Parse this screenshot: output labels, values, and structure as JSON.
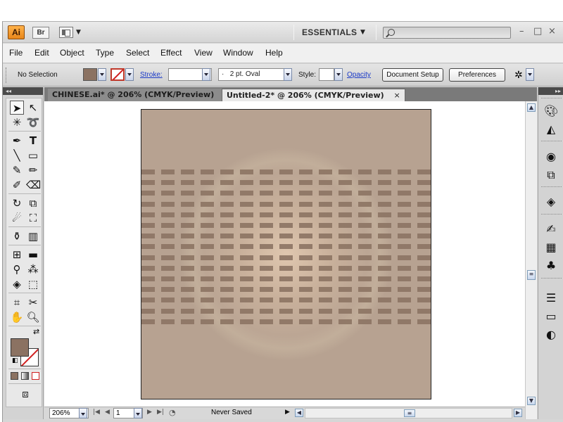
{
  "app": {
    "logo": "Ai",
    "bridge_label": "Br",
    "workspace": "ESSENTIALS",
    "search_placeholder": "",
    "window_controls": {
      "minimize": "–",
      "restore": "□",
      "close": "×"
    }
  },
  "menu": [
    "File",
    "Edit",
    "Object",
    "Type",
    "Select",
    "Effect",
    "View",
    "Window",
    "Help"
  ],
  "control_bar": {
    "selection_label": "No Selection",
    "fill_color": "#8b7262",
    "stroke_label": "Stroke:",
    "stroke_weight": "",
    "brush_label": "2 pt. Oval",
    "brush_prefix": "·",
    "style_label": "Style:",
    "opacity_label": "Opacity",
    "document_setup": "Document Setup",
    "preferences": "Preferences"
  },
  "tabs": [
    {
      "label": "CHINESE.ai* @ 206% (CMYK/Preview)",
      "close": "×",
      "active": false
    },
    {
      "label": "Untitled-2* @ 206% (CMYK/Preview)",
      "close": "×",
      "active": true
    }
  ],
  "tools": [
    "selection-tool",
    "direct-selection-tool",
    "magic-wand-tool",
    "lasso-tool",
    "pen-tool",
    "type-tool",
    "line-segment-tool",
    "rectangle-tool",
    "paintbrush-tool",
    "pencil-tool",
    "blob-brush-tool",
    "eraser-tool",
    "rotate-tool",
    "scale-tool",
    "warp-tool",
    "free-transform-tool",
    "symbol-sprayer-tool",
    "column-graph-tool",
    "mesh-tool",
    "gradient-tool",
    "eyedropper-tool",
    "blend-tool",
    "live-paint-bucket-tool",
    "live-paint-selection-tool",
    "artboard-tool",
    "slice-tool",
    "hand-tool",
    "zoom-tool"
  ],
  "colors": {
    "fill": "#8b7262",
    "stroke_none": "#d02020",
    "artboard_base": "#b7a291",
    "stripe": "#8d7564"
  },
  "status_bar": {
    "zoom": "206%",
    "page": "1",
    "status_text": "Never Saved"
  },
  "right_panels": [
    "color-icon",
    "color-guide-icon",
    "appearance-icon",
    "graphic-styles-icon",
    "layers-icon",
    "brushes-icon",
    "swatches-icon",
    "symbols-icon",
    "stroke-icon",
    "gradient-icon",
    "transparency-icon"
  ]
}
